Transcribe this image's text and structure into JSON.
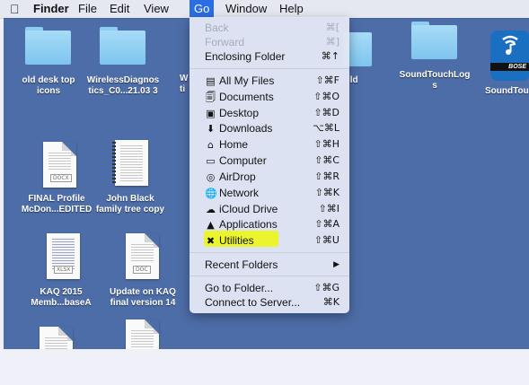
{
  "menubar": {
    "apple": "",
    "items": [
      "Finder",
      "File",
      "Edit",
      "View",
      "Go",
      "Window",
      "Help"
    ],
    "active": "Go"
  },
  "desktop": {
    "background": "#4d6da8",
    "folders": [
      {
        "label_line1": "old desk top",
        "label_line2": "icons"
      },
      {
        "label_line1": "WirelessDiagnos",
        "label_line2": "tics_C0...21.03 3"
      },
      {
        "label_line1": "SoundTouchLog",
        "label_line2": "s"
      }
    ],
    "partial_labels": {
      "left_line1": "W",
      "left_line2": "ti",
      "right": "ild"
    },
    "app_icon": {
      "label": "SoundTou",
      "brand": "BOSE"
    },
    "files": [
      {
        "label_line1": "FINAL Profile",
        "label_line2": "McDon...EDITED",
        "badge": "DOCX"
      },
      {
        "label_line1": "John Black",
        "label_line2": "family tree copy",
        "badge": ""
      },
      {
        "label_line1": "KAQ 2015",
        "label_line2": "Memb...baseA",
        "badge": "XLSX"
      },
      {
        "label_line1": "Update on KAQ",
        "label_line2": "final version 14",
        "badge": "DOC"
      }
    ]
  },
  "go_menu": {
    "highlight_color": "#eaf52e",
    "items": [
      {
        "label": "Back",
        "shortcut": "⌘[",
        "icon": "",
        "disabled": true
      },
      {
        "label": "Forward",
        "shortcut": "⌘]",
        "icon": "",
        "disabled": true
      },
      {
        "label": "Enclosing Folder",
        "shortcut": "⌘↑",
        "icon": ""
      },
      {
        "label": "All My Files",
        "shortcut": "⇧⌘F",
        "icon": "all-files-icon"
      },
      {
        "label": "Documents",
        "shortcut": "⇧⌘O",
        "icon": "documents-icon"
      },
      {
        "label": "Desktop",
        "shortcut": "⇧⌘D",
        "icon": "desktop-icon"
      },
      {
        "label": "Downloads",
        "shortcut": "⌥⌘L",
        "icon": "downloads-icon"
      },
      {
        "label": "Home",
        "shortcut": "⇧⌘H",
        "icon": "home-icon"
      },
      {
        "label": "Computer",
        "shortcut": "⇧⌘C",
        "icon": "computer-icon"
      },
      {
        "label": "AirDrop",
        "shortcut": "⇧⌘R",
        "icon": "airdrop-icon"
      },
      {
        "label": "Network",
        "shortcut": "⇧⌘K",
        "icon": "network-icon"
      },
      {
        "label": "iCloud Drive",
        "shortcut": "⇧⌘I",
        "icon": "cloud-icon"
      },
      {
        "label": "Applications",
        "shortcut": "⇧⌘A",
        "icon": "applications-icon"
      },
      {
        "label": "Utilities",
        "shortcut": "⇧⌘U",
        "icon": "utilities-icon",
        "highlighted": true
      },
      {
        "label": "Recent Folders",
        "shortcut": "▶",
        "icon": ""
      },
      {
        "label": "Go to Folder...",
        "shortcut": "⇧⌘G",
        "icon": ""
      },
      {
        "label": "Connect to Server...",
        "shortcut": "⌘K",
        "icon": ""
      }
    ]
  }
}
